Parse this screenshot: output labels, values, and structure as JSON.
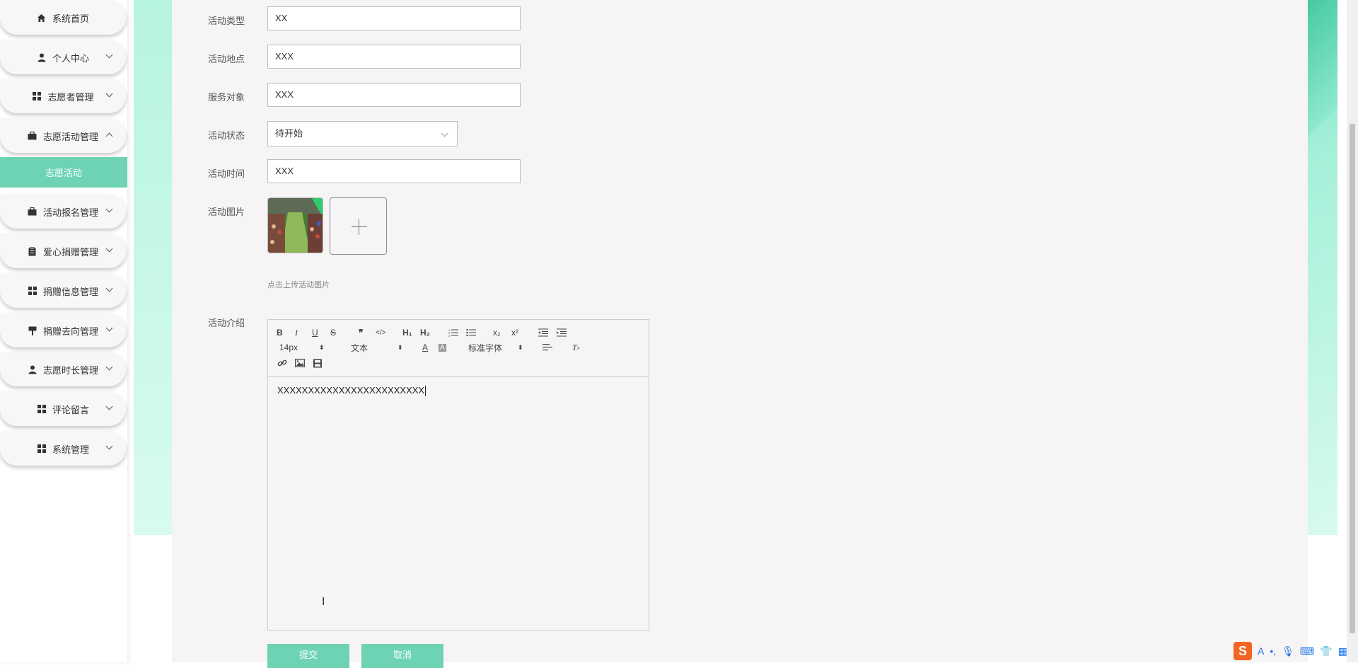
{
  "sidebar": {
    "items": [
      {
        "label": "系统首页",
        "icon": "home-icon",
        "has_chevron": false
      },
      {
        "label": "个人中心",
        "icon": "user-icon",
        "has_chevron": true
      },
      {
        "label": "志愿者管理",
        "icon": "grid-icon",
        "has_chevron": true
      },
      {
        "label": "志愿活动管理",
        "icon": "briefcase-icon",
        "has_chevron": true,
        "expanded": true
      },
      {
        "label": "活动报名管理",
        "icon": "briefcase-icon",
        "has_chevron": true
      },
      {
        "label": "爱心捐赠管理",
        "icon": "clipboard-icon",
        "has_chevron": true
      },
      {
        "label": "捐赠信息管理",
        "icon": "grid-icon",
        "has_chevron": true
      },
      {
        "label": "捐赠去向管理",
        "icon": "signpost-icon",
        "has_chevron": true
      },
      {
        "label": "志愿时长管理",
        "icon": "user-icon",
        "has_chevron": true
      },
      {
        "label": "评论留言",
        "icon": "grid-icon",
        "has_chevron": true
      },
      {
        "label": "系统管理",
        "icon": "grid-icon",
        "has_chevron": true
      }
    ],
    "active_sub_item": "志愿活动"
  },
  "form": {
    "activity_type": {
      "label": "活动类型",
      "value": "XX"
    },
    "location": {
      "label": "活动地点",
      "value": "XXX"
    },
    "service_target": {
      "label": "服务对象",
      "value": "XXX"
    },
    "status": {
      "label": "活动状态",
      "value": "待开始"
    },
    "time": {
      "label": "活动时间",
      "value": "XXX"
    },
    "image": {
      "label": "活动图片",
      "hint": "点击上传活动图片"
    },
    "intro": {
      "label": "活动介绍",
      "toolbar": {
        "font_size": "14px",
        "heading": "文本",
        "font_family": "标准字体"
      },
      "content": "XXXXXXXXXXXXXXXXXXXXXXXX"
    }
  },
  "buttons": {
    "submit": "提交",
    "cancel": "取消"
  },
  "colors": {
    "accent": "#6dd3b4",
    "panel_bg": "#f6f4f5",
    "decor_mint": "#b6f3e0"
  }
}
